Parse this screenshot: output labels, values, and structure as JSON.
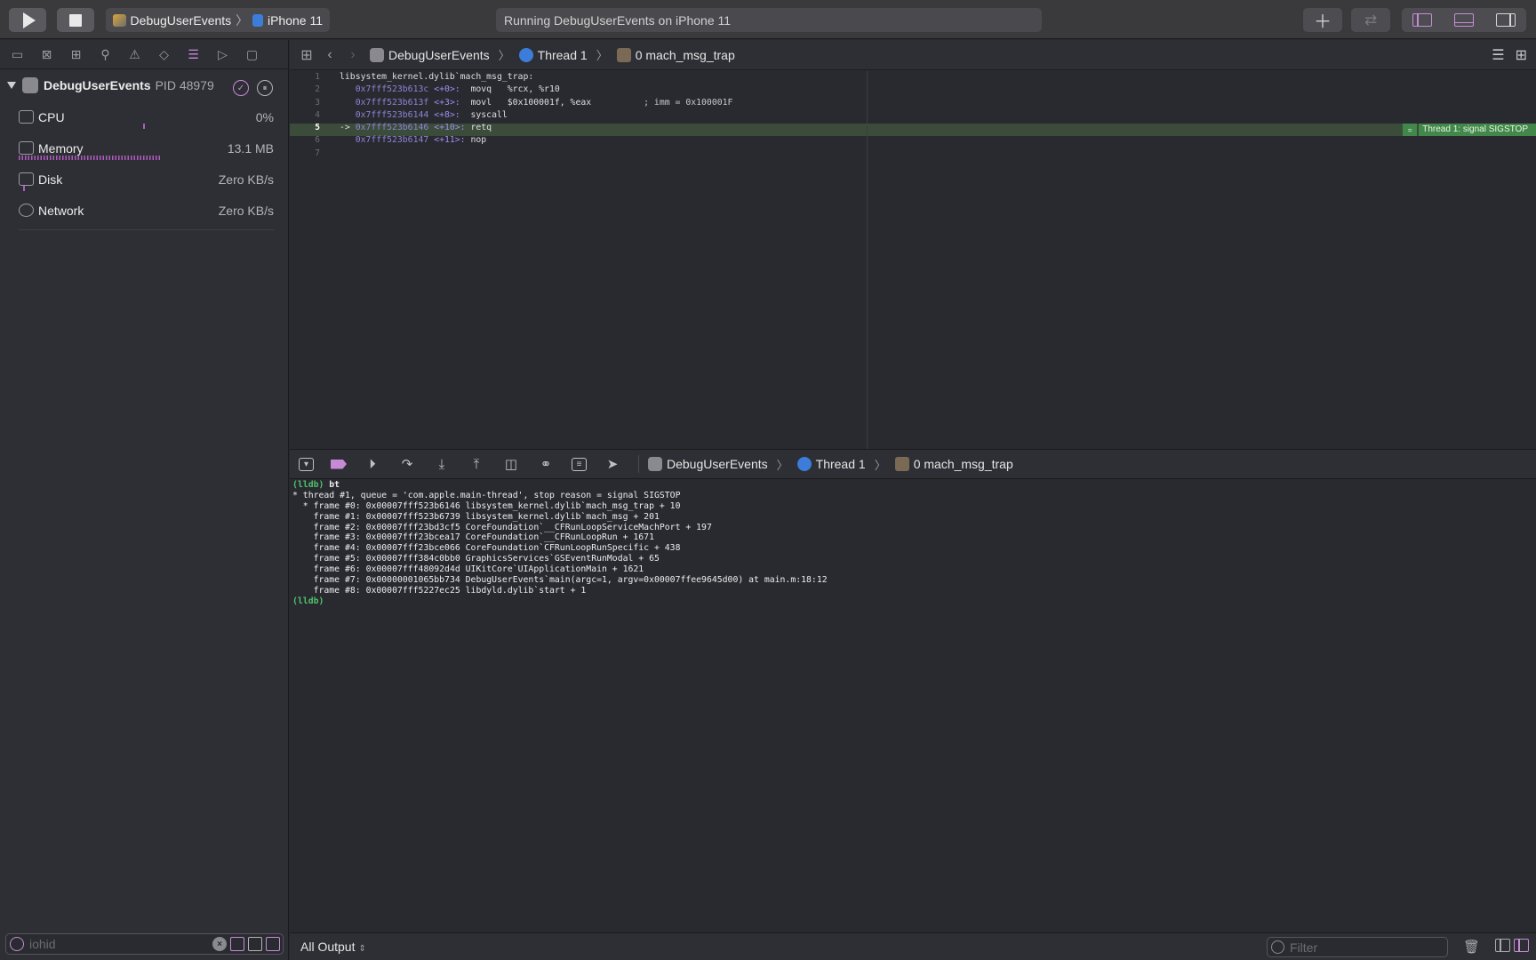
{
  "toolbar": {
    "scheme_name": "DebugUserEvents",
    "device_name": "iPhone 11",
    "status_text": "Running DebugUserEvents on iPhone 11",
    "add_icon": "plus-icon",
    "swap_icon": "arrows-swap-icon",
    "accent_color": "#c78bd6"
  },
  "navigator": {
    "process_name": "DebugUserEvents",
    "pid_label": "PID 48979",
    "gauges": [
      {
        "label": "CPU",
        "value": "0%",
        "level": 0.01
      },
      {
        "label": "Memory",
        "value": "13.1 MB",
        "level": 0.56
      },
      {
        "label": "Disk",
        "value": "Zero KB/s",
        "level": 0
      },
      {
        "label": "Network",
        "value": "Zero KB/s",
        "level": 0
      }
    ],
    "filter_value": "",
    "filter_placeholder": "iohid"
  },
  "jumpbar": {
    "project": "DebugUserEvents",
    "thread": "Thread 1",
    "frame": "0 mach_msg_trap"
  },
  "editor": {
    "line_numbers": [
      "1",
      "2",
      "3",
      "4",
      "5",
      "6",
      "7"
    ],
    "current_line": "5",
    "header": "libsystem_kernel.dylib`mach_msg_trap:",
    "lines": [
      {
        "arrow": "  ",
        "addr": "0x7fff523b613c",
        "off": "<+0>:",
        "instr": "  movq   %rcx, %r10",
        "extra": ""
      },
      {
        "arrow": "  ",
        "addr": "0x7fff523b613f",
        "off": "<+3>:",
        "instr": "  movl   $0x100001f, %eax",
        "extra": "          ; imm = 0x100001F"
      },
      {
        "arrow": "  ",
        "addr": "0x7fff523b6144",
        "off": "<+8>:",
        "instr": "  syscall",
        "extra": ""
      },
      {
        "arrow": "->",
        "addr": "0x7fff523b6146",
        "off": "<+10>:",
        "instr": " retq",
        "extra": ""
      },
      {
        "arrow": "  ",
        "addr": "0x7fff523b6147",
        "off": "<+11>:",
        "instr": " nop",
        "extra": ""
      }
    ],
    "signal_label": "Thread 1: signal SIGSTOP",
    "highlight_color": "#41884a"
  },
  "debugbar": {
    "project": "DebugUserEvents",
    "thread": "Thread 1",
    "frame": "0 mach_msg_trap"
  },
  "console": {
    "prompt": "(lldb)",
    "command": " bt",
    "output": [
      "* thread #1, queue = 'com.apple.main-thread', stop reason = signal SIGSTOP",
      "  * frame #0: 0x00007fff523b6146 libsystem_kernel.dylib`mach_msg_trap + 10",
      "    frame #1: 0x00007fff523b6739 libsystem_kernel.dylib`mach_msg + 201",
      "    frame #2: 0x00007fff23bd3cf5 CoreFoundation`__CFRunLoopServiceMachPort + 197",
      "    frame #3: 0x00007fff23bcea17 CoreFoundation`__CFRunLoopRun + 1671",
      "    frame #4: 0x00007fff23bce066 CoreFoundation`CFRunLoopRunSpecific + 438",
      "    frame #5: 0x00007fff384c0bb0 GraphicsServices`GSEventRunModal + 65",
      "    frame #6: 0x00007fff48092d4d UIKitCore`UIApplicationMain + 1621",
      "    frame #7: 0x00000001065bb734 DebugUserEvents`main(argc=1, argv=0x00007ffee9645d00) at main.m:18:12",
      "    frame #8: 0x00007fff5227ec25 libdyld.dylib`start + 1"
    ],
    "prompt_end": "(lldb)"
  },
  "bottombar": {
    "output_select": "All Output",
    "filter_value": "",
    "filter_placeholder": "Filter"
  }
}
